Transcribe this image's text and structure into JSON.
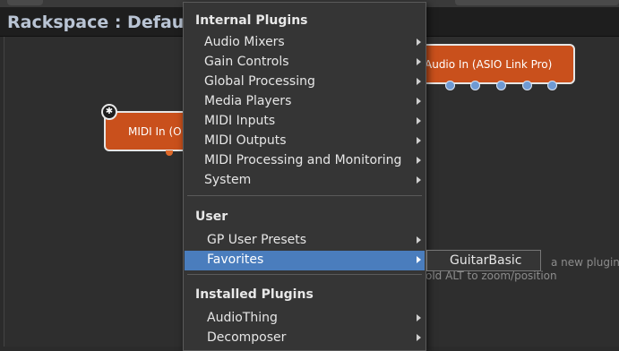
{
  "rackspace": {
    "title": "Rackspace : Default"
  },
  "canvas": {
    "hint_line1": "a new plugin.",
    "hint_line2": "old ALT to zoom/position"
  },
  "nodes": {
    "audio_in": {
      "label": "Audio In (ASIO Link Pro)"
    },
    "midi_in": {
      "label": "MIDI In (O"
    }
  },
  "menu": {
    "sections": [
      {
        "title": "Internal Plugins",
        "items": [
          "Audio Mixers",
          "Gain Controls",
          "Global Processing",
          "Media Players",
          "MIDI Inputs",
          "MIDI Outputs",
          "MIDI Processing and Monitoring",
          "System"
        ]
      },
      {
        "title": "User",
        "items": [
          "GP User Presets",
          "Favorites"
        ]
      },
      {
        "title": "Installed Plugins",
        "items": [
          "AudioThing",
          "Decomposer"
        ]
      }
    ],
    "selected": "Favorites"
  },
  "submenu": {
    "items": [
      "GuitarBasic"
    ]
  },
  "colors": {
    "node": "#c9501c",
    "selection": "#4a7dbd",
    "pin": "#6f9ad3"
  }
}
